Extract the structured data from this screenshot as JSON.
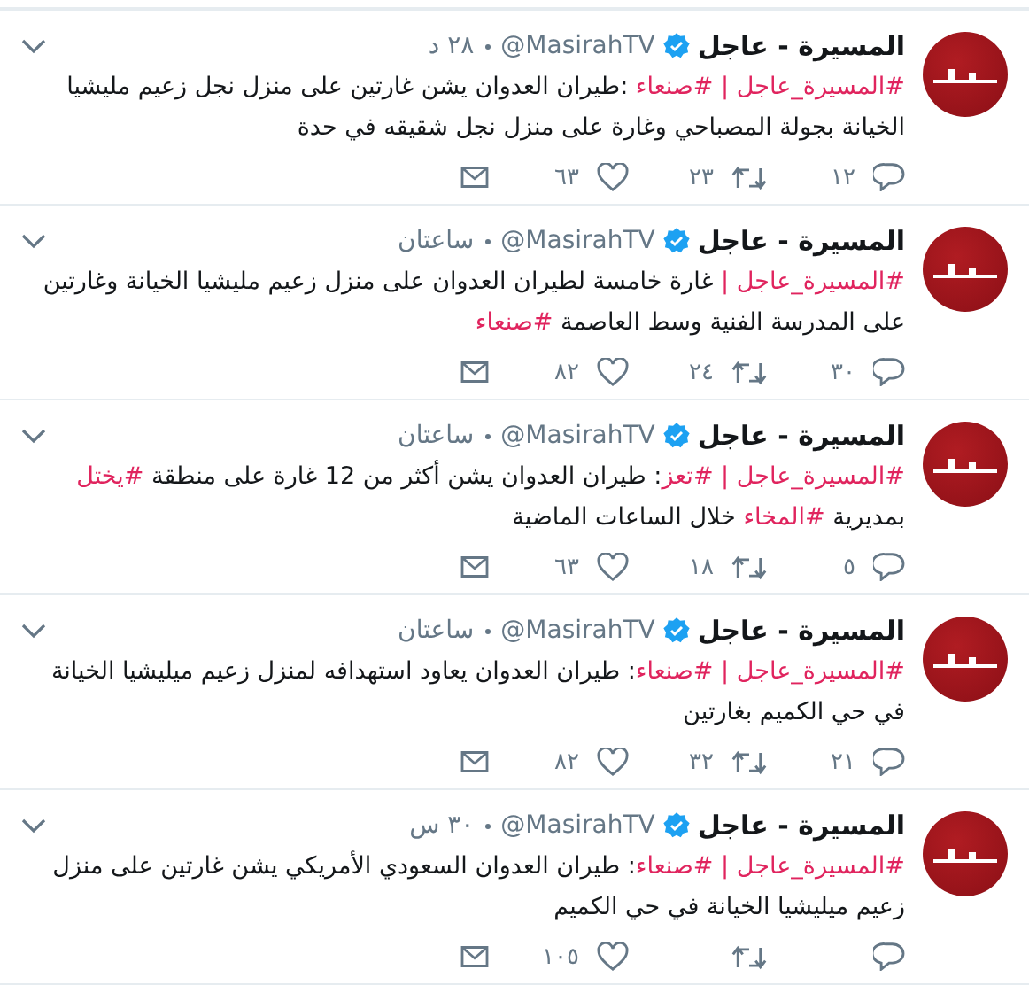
{
  "tweets": [
    {
      "name": "المسيرة - عاجل",
      "verified": true,
      "handle": "@MasirahTV",
      "time": "٢٨ د",
      "body": [
        {
          "kind": "hashtag",
          "text": "#المسيرة_عاجل | "
        },
        {
          "kind": "hashtag",
          "text": "#صنعاء"
        },
        {
          "kind": "plain",
          "text": " :طيران العدوان يشن غارتين على منزل نجل زعيم مليشيا الخيانة بجولة المصباحي وغارة على منزل نجل شقيقه في حدة"
        }
      ],
      "replies": "١٢",
      "retweets": "٢٣",
      "likes": "٦٣"
    },
    {
      "name": "المسيرة - عاجل",
      "verified": true,
      "handle": "@MasirahTV",
      "time": "ساعتان",
      "body": [
        {
          "kind": "hashtag",
          "text": "#المسيرة_عاجل |"
        },
        {
          "kind": "plain",
          "text": " غارة خامسة لطيران العدوان على منزل زعيم مليشيا الخيانة وغارتين على المدرسة الفنية وسط العاصمة "
        },
        {
          "kind": "hashtag",
          "text": "#صنعاء"
        }
      ],
      "replies": "٣٠",
      "retweets": "٢٤",
      "likes": "٨٢"
    },
    {
      "name": "المسيرة - عاجل",
      "verified": true,
      "handle": "@MasirahTV",
      "time": "ساعتان",
      "body": [
        {
          "kind": "hashtag",
          "text": "#المسيرة_عاجل | "
        },
        {
          "kind": "hashtag",
          "text": "#تعز"
        },
        {
          "kind": "plain",
          "text": ": طيران العدوان يشن أكثر من 12 غارة على منطقة "
        },
        {
          "kind": "hashtag",
          "text": "#يختل"
        },
        {
          "kind": "plain",
          "text": " بمديرية "
        },
        {
          "kind": "hashtag",
          "text": "#المخاء"
        },
        {
          "kind": "plain",
          "text": " خلال الساعات الماضية"
        }
      ],
      "replies": "٥",
      "retweets": "١٨",
      "likes": "٦٣"
    },
    {
      "name": "المسيرة - عاجل",
      "verified": true,
      "handle": "@MasirahTV",
      "time": "ساعتان",
      "body": [
        {
          "kind": "hashtag",
          "text": "#المسيرة_عاجل | "
        },
        {
          "kind": "hashtag",
          "text": "#صنعاء"
        },
        {
          "kind": "plain",
          "text": ": طيران العدوان يعاود استهدافه لمنزل زعيم ميليشيا الخيانة في حي الكميم بغارتين"
        }
      ],
      "replies": "٢١",
      "retweets": "٣٢",
      "likes": "٨٢"
    },
    {
      "name": "المسيرة - عاجل",
      "verified": true,
      "handle": "@MasirahTV",
      "time": "٣٠ س",
      "body": [
        {
          "kind": "hashtag",
          "text": "#المسيرة_عاجل | "
        },
        {
          "kind": "hashtag",
          "text": "#صنعاء"
        },
        {
          "kind": "plain",
          "text": ": طيران العدوان السعودي الأمريكي يشن غارتين على منزل زعيم ميليشيا الخيانة في حي الكميم"
        }
      ],
      "likes": "١٠٥"
    }
  ]
}
